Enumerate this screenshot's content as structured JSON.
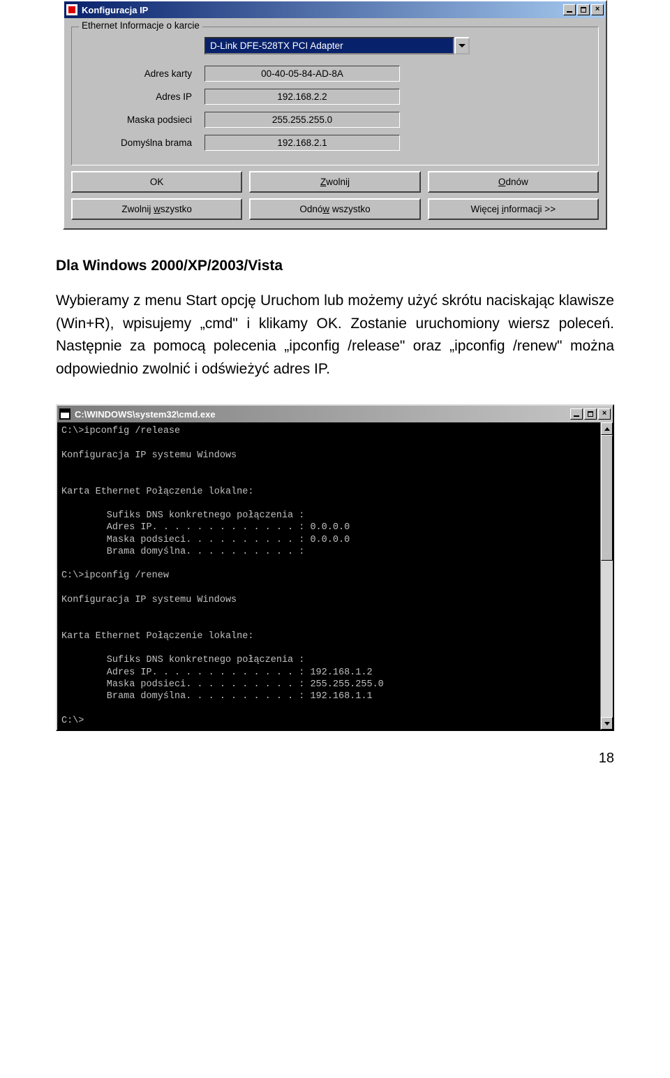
{
  "ipdlg": {
    "title": "Konfiguracja IP",
    "group_legend": "Ethernet  Informacje o karcie",
    "adapter": "D-Link DFE-528TX PCI Adapter",
    "fields": [
      {
        "label": "Adres karty",
        "value": "00-40-05-84-AD-8A"
      },
      {
        "label": "Adres IP",
        "value": "192.168.2.2"
      },
      {
        "label": "Maska podsieci",
        "value": "255.255.255.0"
      },
      {
        "label": "Domyślna brama",
        "value": "192.168.2.1"
      }
    ],
    "buttons_row1": {
      "ok": "OK",
      "zwolnij": "Zwolnij",
      "odnow": "Odnów"
    },
    "buttons_row2": {
      "zwolnij_w": "Zwolnij wszystko",
      "odnow_w": "Odnów wszystko",
      "wiecej": "Więcej informacji >>"
    }
  },
  "doc": {
    "heading": "Dla Windows 2000/XP/2003/Vista",
    "paragraph": "Wybieramy z menu Start opcję Uruchom lub możemy użyć skrótu naciskając klawisze (Win+R), wpisujemy „cmd\" i klikamy OK. Zostanie uruchomiony wiersz poleceń. Następnie za pomocą polecenia „ipconfig /release\" oraz „ipconfig /renew\" można odpowiednio zwolnić i odświeżyć adres IP.",
    "page_number": "18"
  },
  "cmd": {
    "title": "C:\\WINDOWS\\system32\\cmd.exe",
    "lines": [
      "C:\\>ipconfig /release",
      "",
      "Konfiguracja IP systemu Windows",
      "",
      "",
      "Karta Ethernet Połączenie lokalne:",
      "",
      "        Sufiks DNS konkretnego połączenia :",
      "        Adres IP. . . . . . . . . . . . . : 0.0.0.0",
      "        Maska podsieci. . . . . . . . . . : 0.0.0.0",
      "        Brama domyślna. . . . . . . . . . :",
      "",
      "C:\\>ipconfig /renew",
      "",
      "Konfiguracja IP systemu Windows",
      "",
      "",
      "Karta Ethernet Połączenie lokalne:",
      "",
      "        Sufiks DNS konkretnego połączenia :",
      "        Adres IP. . . . . . . . . . . . . : 192.168.1.2",
      "        Maska podsieci. . . . . . . . . . : 255.255.255.0",
      "        Brama domyślna. . . . . . . . . . : 192.168.1.1",
      "",
      "C:\\>"
    ]
  }
}
